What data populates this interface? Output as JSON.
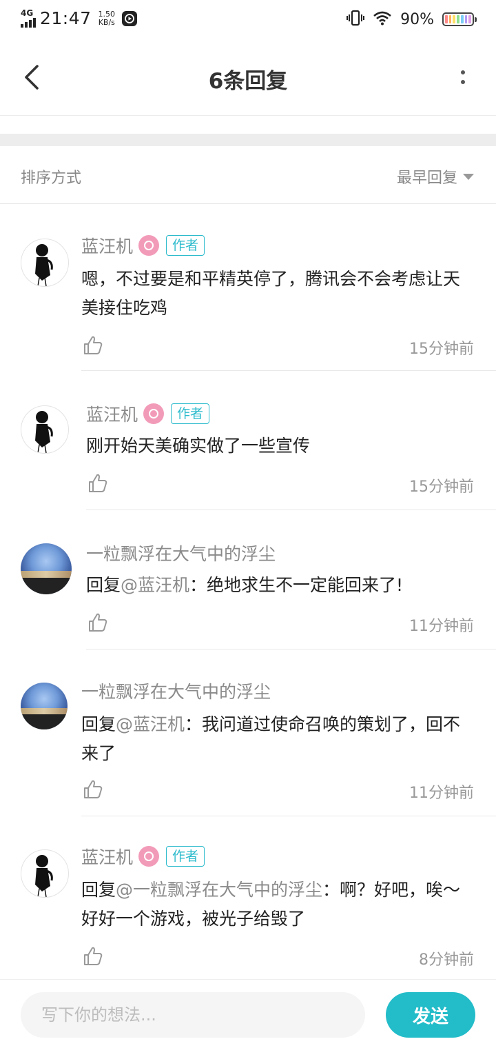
{
  "status_bar": {
    "network": "4G",
    "time": "21:47",
    "speed_value": "1.50",
    "speed_unit": "KB/s",
    "battery_percent": "90%"
  },
  "header": {
    "title": "6条回复"
  },
  "sort": {
    "label": "排序方式",
    "selected": "最早回复"
  },
  "replies": [
    {
      "username": "蓝汪机",
      "is_author": true,
      "author_tag": "作者",
      "mention": "",
      "text": "嗯，不过要是和平精英停了，腾讯会不会考虑让天美接住吃鸡",
      "time_ago": "15分钟前",
      "avatar": "sketch"
    },
    {
      "username": "蓝汪机",
      "is_author": true,
      "author_tag": "作者",
      "mention": "",
      "text": "刚开始天美确实做了一些宣传",
      "time_ago": "15分钟前",
      "avatar": "sketch"
    },
    {
      "username": "一粒飘浮在大气中的浮尘",
      "is_author": false,
      "author_tag": "",
      "mention": "回复@蓝汪机：",
      "mention_prefix": "回复",
      "mention_name": "@蓝汪机",
      "mention_suffix": "：",
      "text": "绝地求生不一定能回来了!",
      "time_ago": "11分钟前",
      "avatar": "sky"
    },
    {
      "username": "一粒飘浮在大气中的浮尘",
      "is_author": false,
      "author_tag": "",
      "mention_prefix": "回复",
      "mention_name": "@蓝汪机",
      "mention_suffix": "：",
      "text": "我问道过使命召唤的策划了，回不来了",
      "time_ago": "11分钟前",
      "avatar": "sky"
    },
    {
      "username": "蓝汪机",
      "is_author": true,
      "author_tag": "作者",
      "mention_prefix": "回复",
      "mention_name": "@一粒飘浮在大气中的浮尘",
      "mention_suffix": "：",
      "text": "啊？好吧，唉～好好一个游戏，被光子给毁了",
      "time_ago": "8分钟前",
      "avatar": "sketch"
    }
  ],
  "composer": {
    "placeholder": "写下你的想法...",
    "send_label": "发送"
  },
  "colors": {
    "accent": "#23bcc9",
    "author_tag": "#2cbbcc",
    "medal": "#f29bb8",
    "username": "#8a8a8a"
  },
  "icons": [
    "back-arrow-icon",
    "more-vertical-icon",
    "caret-down-icon",
    "thumbs-up-icon",
    "vibrate-icon",
    "wifi-icon",
    "battery-icon",
    "signal-icon",
    "medal-icon"
  ]
}
